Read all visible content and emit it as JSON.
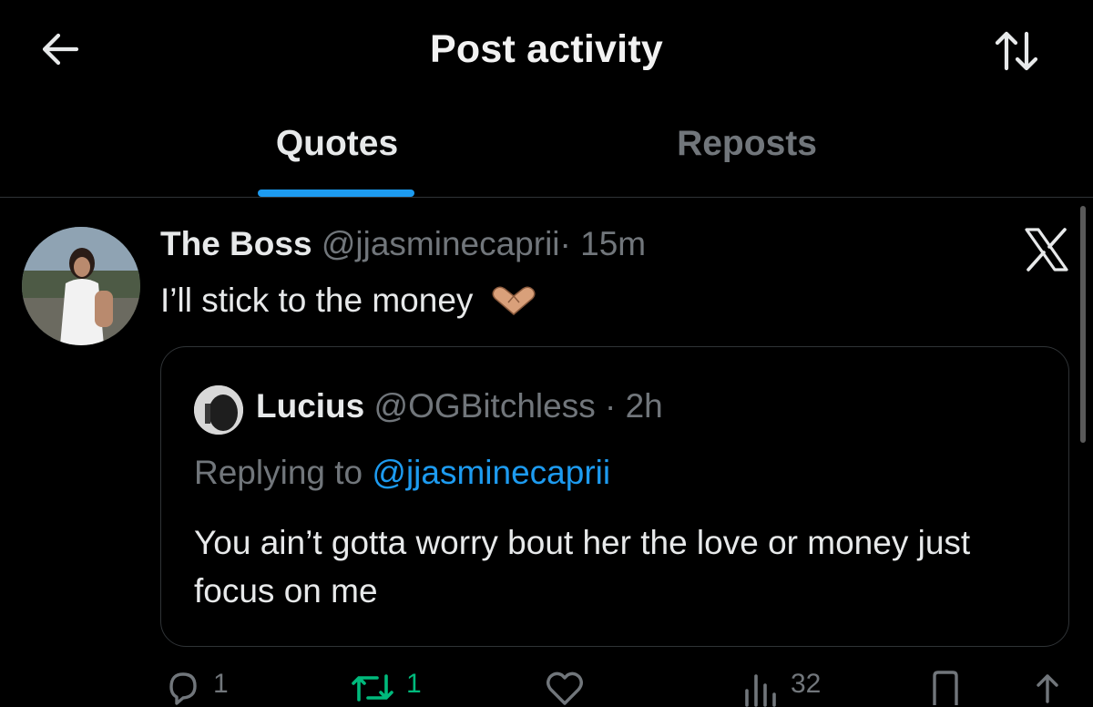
{
  "header": {
    "title": "Post activity",
    "back_icon": "arrow-left-icon",
    "sort_icon": "sort-arrows-icon"
  },
  "tabs": [
    {
      "label": "Quotes",
      "active": true
    },
    {
      "label": "Reposts",
      "active": false
    }
  ],
  "tweet": {
    "display_name": "The Boss",
    "handle": "@jjasminecaprii",
    "time": "· 15m",
    "text": "I’ll stick to the money",
    "emoji": "heart-hands-emoji",
    "source_icon": "x-logo-icon",
    "quoted": {
      "display_name": "Lucius",
      "handle": "@OGBitchless",
      "time": "· 2h",
      "replying_prefix": "Replying to ",
      "replying_handle": "@jjasminecaprii",
      "text": "You ain’t gotta worry bout her the love or money just focus on me"
    },
    "actions": {
      "replies": "1",
      "reposts": "1",
      "views": "32"
    }
  },
  "colors": {
    "background": "#000000",
    "accent": "#1d9bf0",
    "muted": "#71767b",
    "repost": "#00ba7c"
  }
}
